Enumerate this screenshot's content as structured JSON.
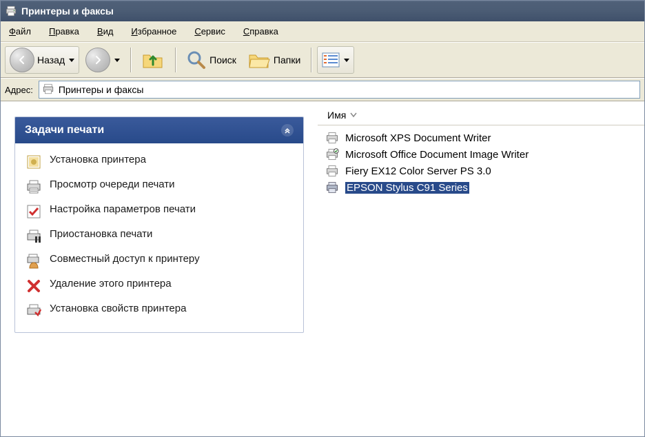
{
  "titlebar": {
    "text": "Принтеры и факсы"
  },
  "menu": {
    "file": "Файл",
    "edit": "Правка",
    "view": "Вид",
    "favorites": "Избранное",
    "tools": "Сервис",
    "help": "Справка",
    "file_u": "Ф",
    "edit_u": "П",
    "view_u": "В",
    "favorites_u": "И",
    "tools_u": "С",
    "help_u": "С",
    "file_r": "айл",
    "edit_r": "равка",
    "view_r": "ид",
    "favorites_r": "збранное",
    "tools_r": "ервис",
    "help_r": "правка"
  },
  "toolbar": {
    "back": "Назад",
    "search": "Поиск",
    "folders": "Папки"
  },
  "address": {
    "label_pre": "А",
    "label_u": "д",
    "label_post": "рес:",
    "value": "Принтеры и факсы"
  },
  "tasks": {
    "title": "Задачи печати",
    "items": [
      "Установка принтера",
      "Просмотр очереди печати",
      "Настройка параметров печати",
      "Приостановка печати",
      "Совместный доступ к принтеру",
      "Удаление этого принтера",
      "Установка свойств принтера"
    ]
  },
  "listheader": {
    "name": "Имя"
  },
  "printers": [
    "Microsoft XPS Document Writer",
    "Microsoft Office Document Image Writer",
    "Fiery EX12 Color Server PS 3.0",
    "EPSON Stylus C91 Series"
  ],
  "selected_index": 3
}
